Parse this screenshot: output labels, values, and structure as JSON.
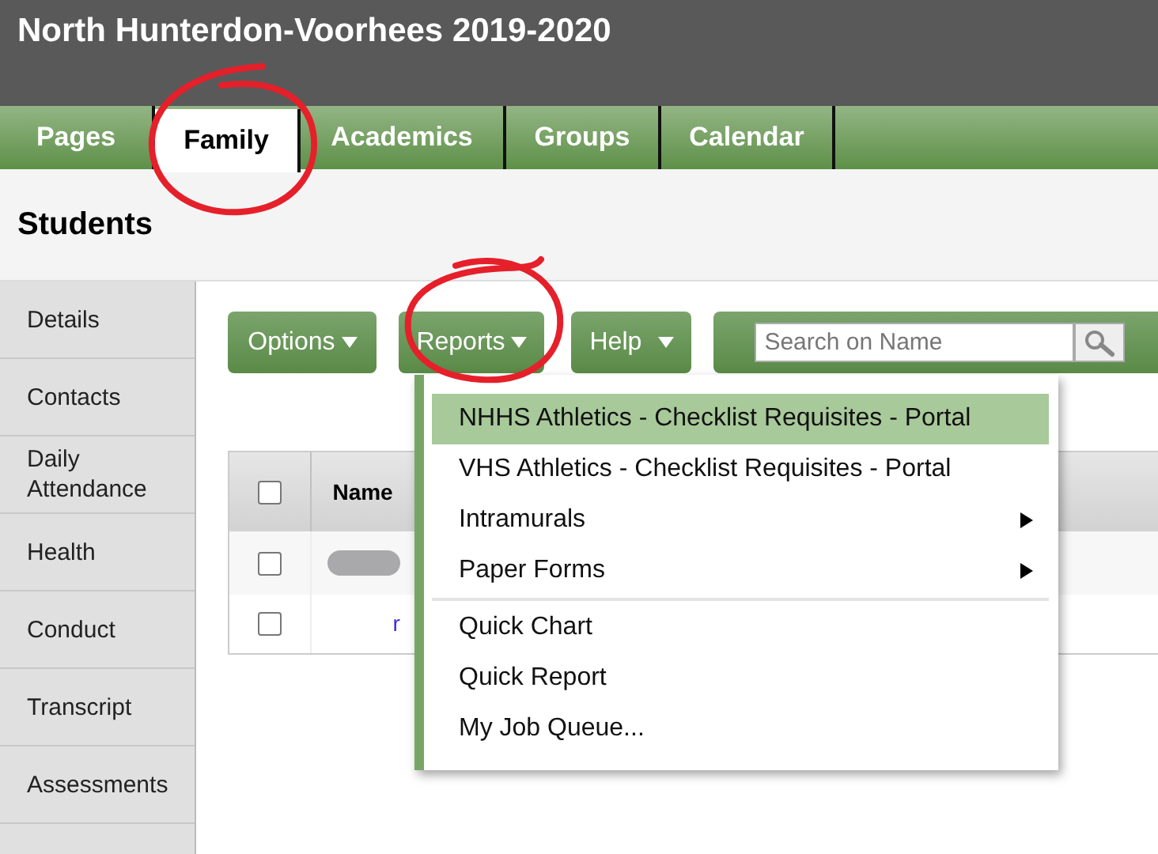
{
  "header": {
    "title": "North Hunterdon-Voorhees 2019-2020"
  },
  "nav_tabs": [
    {
      "label": "Pages",
      "selected": false
    },
    {
      "label": "Family",
      "selected": true
    },
    {
      "label": "Academics",
      "selected": false
    },
    {
      "label": "Groups",
      "selected": false
    },
    {
      "label": "Calendar",
      "selected": false
    }
  ],
  "section_title": "Students",
  "sidebar": {
    "items": [
      "Details",
      "Contacts",
      "Daily Attendance",
      "Health",
      "Conduct",
      "Transcript",
      "Assessments"
    ]
  },
  "toolbar": {
    "buttons": [
      {
        "label": "Options"
      },
      {
        "label": "Reports"
      },
      {
        "label": "Help"
      }
    ],
    "search": {
      "placeholder": "Search on Name"
    }
  },
  "table": {
    "header_checkbox": {
      "checked": false
    },
    "columns": [
      "Name"
    ],
    "rows": [
      {
        "checked": false,
        "kind": "redacted"
      },
      {
        "checked": false,
        "kind": "link",
        "name": "r"
      }
    ]
  },
  "reports_menu": {
    "groups": [
      [
        {
          "label": "NHHS Athletics - Checklist Requisites - Portal",
          "selected": true,
          "submenu": false
        },
        {
          "label": "VHS Athletics - Checklist Requisites - Portal",
          "selected": false,
          "submenu": false
        },
        {
          "label": "Intramurals",
          "selected": false,
          "submenu": true
        },
        {
          "label": "Paper Forms",
          "selected": false,
          "submenu": true
        }
      ],
      [
        {
          "label": "Quick Chart",
          "selected": false,
          "submenu": false
        },
        {
          "label": "Quick Report",
          "selected": false,
          "submenu": false
        },
        {
          "label": "My Job Queue...",
          "selected": false,
          "submenu": false
        }
      ]
    ]
  }
}
